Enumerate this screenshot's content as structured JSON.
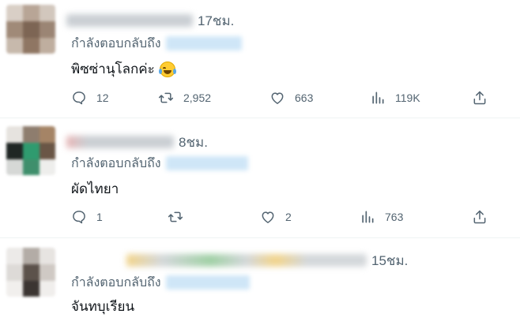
{
  "colors": {
    "text": "#0f1419",
    "secondary": "#536471",
    "divider": "#eff3f4",
    "handle_blur": "#cfe6f7"
  },
  "tweets": [
    {
      "time": "17ชม.",
      "replying_to": "กำลังตอบกลับถึง",
      "text": "พิซซ่านุโลกค่ะ",
      "emoji": "face-with-tears-of-joy",
      "replies": "12",
      "retweets": "2,952",
      "likes": "663",
      "views": "119K"
    },
    {
      "time": "8ชม.",
      "replying_to": "กำลังตอบกลับถึง",
      "text": "ผัดไทยา",
      "replies": "1",
      "retweets": "",
      "likes": "2",
      "views": "763"
    },
    {
      "time": "15ชม.",
      "replying_to": "กำลังตอบกลับถึง",
      "text": "จันทบุเรียน"
    }
  ],
  "icons": {
    "reply": "reply-icon",
    "retweet": "retweet-icon",
    "like": "heart-icon",
    "views": "views-chart-icon",
    "share": "share-icon"
  }
}
